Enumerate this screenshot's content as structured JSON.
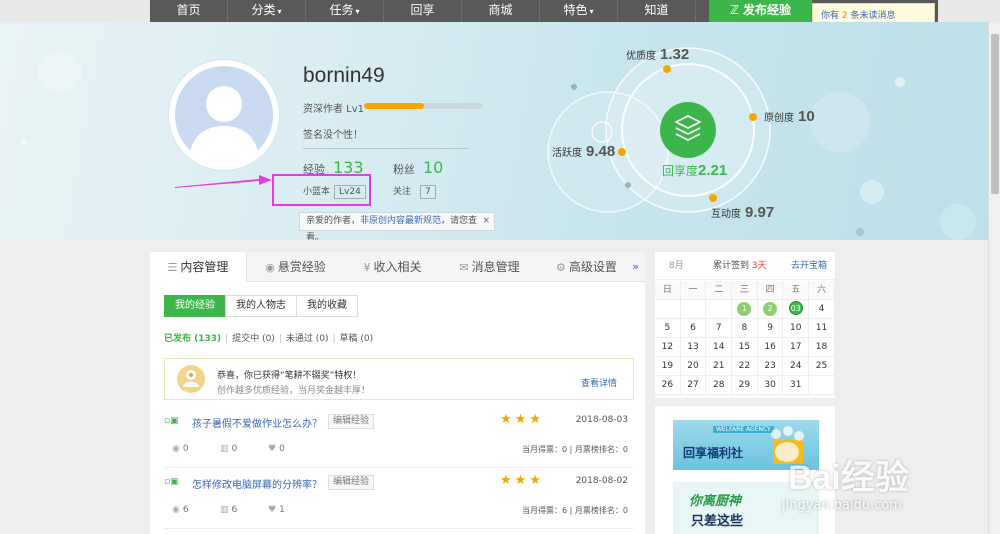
{
  "nav": {
    "items": [
      {
        "label": "首页",
        "caret": false
      },
      {
        "label": "分类",
        "caret": true
      },
      {
        "label": "任务",
        "caret": true
      },
      {
        "label": "回享",
        "caret": false
      },
      {
        "label": "商城",
        "caret": false
      },
      {
        "label": "特色",
        "caret": true
      },
      {
        "label": "知道",
        "caret": false
      }
    ],
    "publish": "发布经验",
    "msg_pre": "你有",
    "msg_num": "2",
    "msg_post": "条未读消息"
  },
  "profile": {
    "username": "bornin49",
    "rank_label": "资深作者 Lv1",
    "rank_progress": 0.5,
    "signature": "签名没个性！",
    "exp_label": "经验",
    "exp_value": "133",
    "fans_label": "粉丝",
    "fans_value": "10",
    "level_label": "小蓝本",
    "level_value": "Lv24",
    "follow_label": "关注",
    "follow_value": "7",
    "tip_text": "亲爱的作者，",
    "tip_link": "非原创内容最新规范",
    "tip_tail": "，请您查看。",
    "tip_close": "×"
  },
  "graph": {
    "quality": {
      "label": "优质度",
      "value": "1.32"
    },
    "original": {
      "label": "原创度",
      "value": "10"
    },
    "active": {
      "label": "活跃度",
      "value": "9.48"
    },
    "share": {
      "label": "回享度",
      "value": "2.21"
    },
    "interact": {
      "label": "互动度",
      "value": "9.97"
    }
  },
  "tabs": [
    {
      "label": "内容管理",
      "icon": "list-icon",
      "glyph": "☰"
    },
    {
      "label": "悬赏经验",
      "icon": "coin-icon",
      "glyph": "◉"
    },
    {
      "label": "收入相关",
      "icon": "yen-icon",
      "glyph": "¥"
    },
    {
      "label": "消息管理",
      "icon": "mail-icon",
      "glyph": "✉"
    },
    {
      "label": "高级设置",
      "icon": "gear-icon",
      "glyph": "⚙"
    }
  ],
  "tab_more": "»",
  "subtabs": [
    "我的经验",
    "我的人物志",
    "我的收藏"
  ],
  "filters": {
    "published": "已发布 (133)",
    "submitted": "提交中 (0)",
    "rejected": "未通过 (0)",
    "draft": "草稿 (0)"
  },
  "notice": {
    "line1": "恭喜，你已获得“笔耕不辍奖”特权！",
    "line2": "创作越多优质经验，当月奖金越丰厚！",
    "more": "查看详情"
  },
  "articles": [
    {
      "title": "孩子暑假不爱做作业怎么办？",
      "edit": "编辑经验",
      "date": "2018-08-03",
      "views": "0",
      "votes": "0",
      "likes": "0",
      "score": "当月得票：0 | 月票榜排名：0",
      "stars": "★★★"
    },
    {
      "title": "怎样修改电脑屏幕的分辨率？",
      "edit": "编辑经验",
      "date": "2018-08-02",
      "views": "6",
      "votes": "6",
      "likes": "1",
      "score": "当月得票：6 | 月票榜排名：0",
      "stars": "★★★"
    }
  ],
  "calendar": {
    "month": "8月",
    "signin_pre": "累计签到",
    "signin_days": "3天",
    "open_box": "去开宝箱",
    "weekdays": [
      "日",
      "一",
      "二",
      "三",
      "四",
      "五",
      "六"
    ],
    "weeks": [
      [
        "",
        "",
        "",
        "1",
        "2",
        "03",
        "4"
      ],
      [
        "5",
        "6",
        "7",
        "8",
        "9",
        "10",
        "11"
      ],
      [
        "12",
        "13",
        "14",
        "15",
        "16",
        "17",
        "18"
      ],
      [
        "19",
        "20",
        "21",
        "22",
        "23",
        "24",
        "25"
      ],
      [
        "26",
        "27",
        "28",
        "29",
        "30",
        "31",
        ""
      ]
    ],
    "signed": [
      "1",
      "2",
      "03"
    ],
    "today": "03"
  },
  "ads": {
    "ad1_ribbon": "WELFARE AGENCY",
    "ad1_title": "回享福利社",
    "ad2_line1": "你离厨神",
    "ad2_line2": "只差这些"
  },
  "watermark": {
    "brand": "Bai经验",
    "url": "jingyan.baidu.com"
  },
  "colors": {
    "accent_green": "#3cb64a",
    "link_blue": "#3a67b5",
    "orange": "#f5a500",
    "highlight_magenta": "#e63ce6"
  }
}
